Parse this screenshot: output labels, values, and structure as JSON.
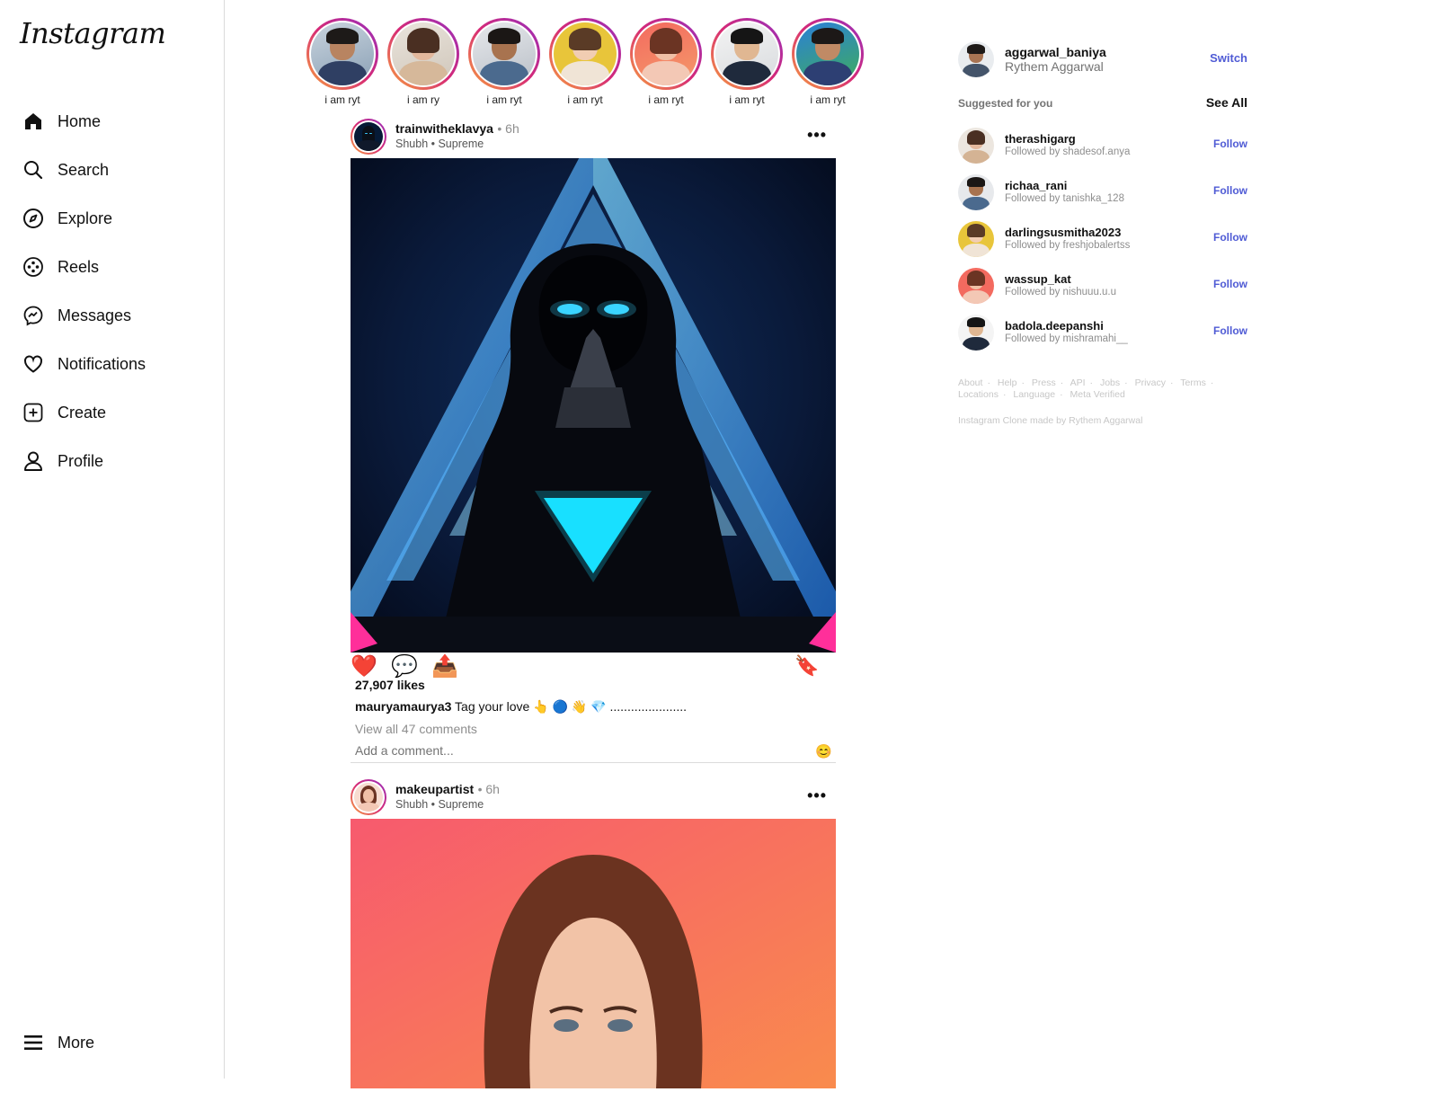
{
  "brand": {
    "logo_text": "Instagram"
  },
  "nav": {
    "items": [
      {
        "label": "Home",
        "icon": "home-icon"
      },
      {
        "label": "Search",
        "icon": "search-icon"
      },
      {
        "label": "Explore",
        "icon": "compass-icon"
      },
      {
        "label": "Reels",
        "icon": "reels-icon"
      },
      {
        "label": "Messages",
        "icon": "messenger-icon"
      },
      {
        "label": "Notifications",
        "icon": "heart-icon"
      },
      {
        "label": "Create",
        "icon": "plus-square-icon"
      },
      {
        "label": "Profile",
        "icon": "user-icon"
      }
    ],
    "more_label": "More"
  },
  "stories": [
    {
      "name": "i am ryt"
    },
    {
      "name": "i am ry"
    },
    {
      "name": "i am ryt"
    },
    {
      "name": "i am ryt"
    },
    {
      "name": "i am ryt"
    },
    {
      "name": "i am ryt"
    },
    {
      "name": "i am ryt"
    }
  ],
  "posts": [
    {
      "user": "trainwitheklavya",
      "time": "• 6h",
      "subtitle": "Shubh • Supreme",
      "more": "•••",
      "likes": "27,907 likes",
      "caption_user": "mauryamaurya3",
      "caption_text": "Tag your love 👆 🔵 👋 💎 ......................",
      "view_comments": "View all 47 comments",
      "comment_placeholder": "Add a comment...",
      "emoji": "😊"
    },
    {
      "user": "makeupartist",
      "time": "• 6h",
      "subtitle": "Shubh • Supreme",
      "more": "•••"
    }
  ],
  "actions": {
    "like": "❤️",
    "comment": "💬",
    "share": "📤",
    "save": "🔖"
  },
  "me": {
    "username": "aggarwal_baniya",
    "name": "Rythem Aggarwal",
    "switch_label": "Switch"
  },
  "suggestions": {
    "title": "Suggested for you",
    "see_all": "See All",
    "follow_label": "Follow",
    "items": [
      {
        "username": "therashigarg",
        "followed_by": "Followed by shadesof.anya"
      },
      {
        "username": "richaa_rani",
        "followed_by": "Followed by tanishka_128"
      },
      {
        "username": "darlingsusmitha2023",
        "followed_by": "Followed by freshjobalertss"
      },
      {
        "username": "wassup_kat",
        "followed_by": "Followed by nishuuu.u.u"
      },
      {
        "username": "badola.deepanshi",
        "followed_by": "Followed by mishramahi__"
      }
    ]
  },
  "footer": {
    "links": [
      "About",
      "Help",
      "Press",
      "API",
      "Jobs",
      "Privacy",
      "Terms",
      "Locations",
      "Language",
      "Meta Verified"
    ],
    "credit": "Instagram Clone made by Rythem Aggarwal"
  },
  "colors": {
    "accent": "#4f5bd5",
    "border": "#dbdbdb",
    "muted": "#8e8e8e"
  }
}
